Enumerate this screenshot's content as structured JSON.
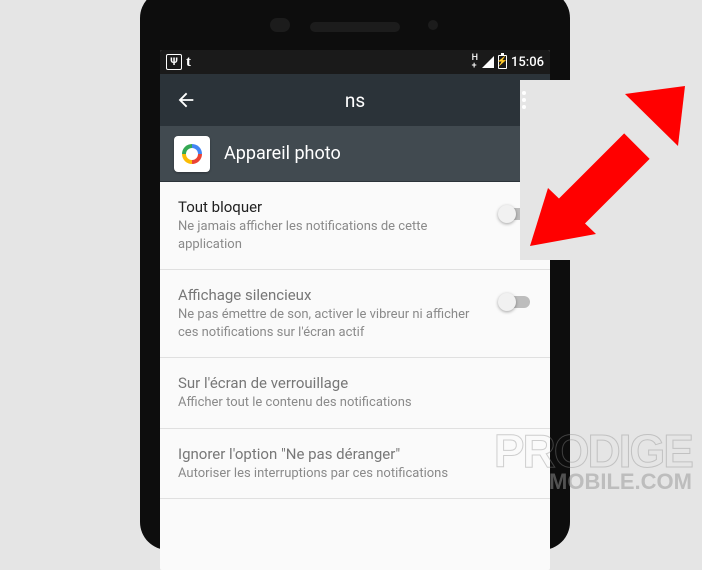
{
  "statusbar": {
    "usb_badge": "Ψ",
    "t_label": "t",
    "net_label": "H\n+",
    "time": "15:06"
  },
  "appbar": {
    "title": "ns"
  },
  "app": {
    "name": "Appareil photo"
  },
  "rows": [
    {
      "title": "Tout bloquer",
      "subtitle": "Ne jamais afficher les notifications de cette application",
      "has_switch": true,
      "on": false
    },
    {
      "title": "Affichage silencieux",
      "subtitle": "Ne pas émettre de son, activer le vibreur ni afficher ces notifications sur l'écran actif",
      "has_switch": true,
      "on": false
    },
    {
      "title": "Sur l'écran de verrouillage",
      "subtitle": "Afficher tout le contenu des notifications",
      "has_switch": false
    },
    {
      "title": "Ignorer l'option \"Ne pas déranger\"",
      "subtitle": "Autoriser les interruptions par ces notifications",
      "has_switch": true,
      "on": false
    }
  ],
  "watermark": {
    "line1": "PRODIGE",
    "line2": "MOBILE.COM"
  },
  "colors": {
    "arrow": "#ff0000",
    "appbar_bg": "#2b3339",
    "appheader_bg": "#414a50"
  }
}
